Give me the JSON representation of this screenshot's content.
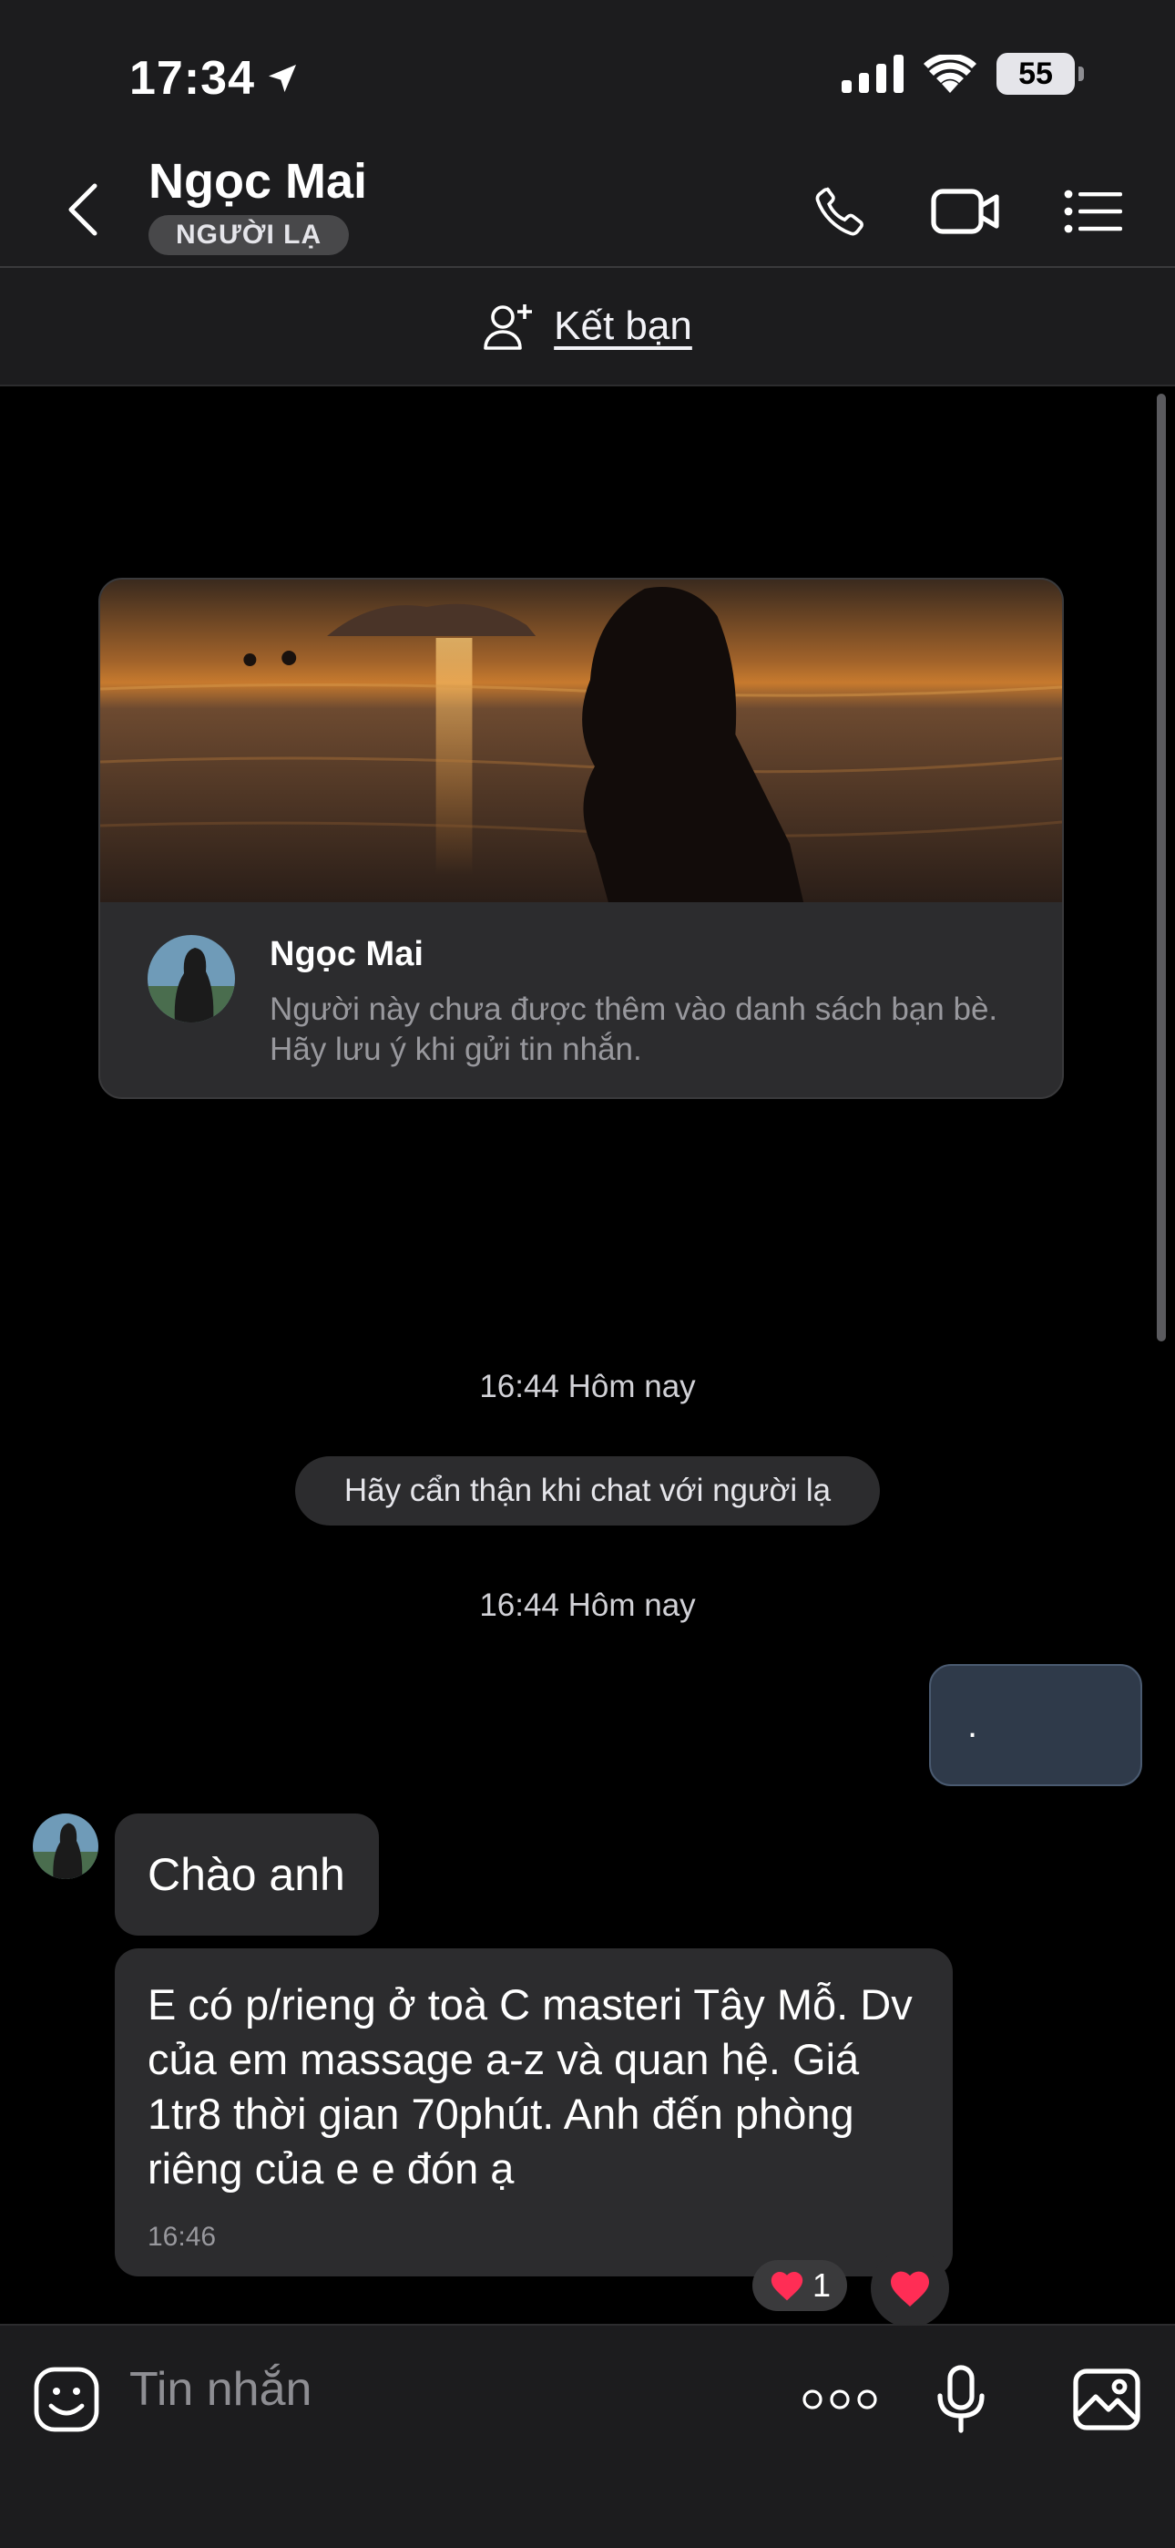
{
  "status": {
    "time": "17:34",
    "battery": "55"
  },
  "header": {
    "name": "Ngọc Mai",
    "badge": "NGƯỜI LẠ"
  },
  "add_friend": {
    "label": "Kết bạn"
  },
  "card": {
    "name": "Ngọc Mai",
    "description": "Người này chưa được thêm vào danh sách bạn bè. Hãy lưu ý khi gửi tin nhắn."
  },
  "chat": {
    "timestamp_1": "16:44 Hôm nay",
    "warning": "Hãy cẩn thận khi chat với người lạ",
    "timestamp_2": "16:44 Hôm nay",
    "sent_message": ".",
    "received": [
      {
        "text": "Chào anh"
      },
      {
        "text": "E có p/rieng ở toà C masteri Tây Mỗ. Dv của em massage a-z và quan hệ. Giá 1tr8 thời gian 70phút. Anh đến phòng riêng của e e đón ạ",
        "time": "16:46"
      }
    ],
    "reaction_count": "1"
  },
  "composer": {
    "placeholder": "Tin nhắn"
  },
  "colors": {
    "header_bg": "#1c1c1e",
    "chat_bg": "#000000",
    "bubble_bg": "#2c2c2e",
    "sent_bubble_bg": "#2f3a4a",
    "heart": "#ff2d55"
  }
}
